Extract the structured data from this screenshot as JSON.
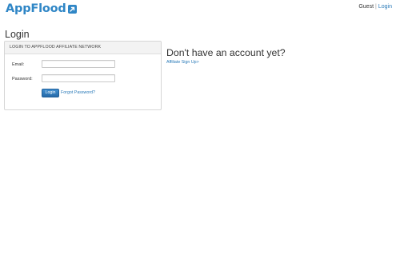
{
  "header": {
    "logo_text": "AppFlood",
    "user_label": "Guest",
    "separator": "|",
    "login_link": "Login"
  },
  "page": {
    "title": "Login"
  },
  "login_panel": {
    "heading": "LOGIN TO APPFLOOD AFFILIATE NETWORK",
    "email_label": "Email:",
    "email_value": "",
    "password_label": "Password:",
    "password_value": "",
    "login_button": "Login",
    "forgot_link": "Forgot Password?"
  },
  "signup": {
    "title": "Don't have an account yet?",
    "link_label": "Affiliate Sign Up",
    "link_arrow": ">"
  },
  "colors": {
    "brand": "#2f86c6",
    "link": "#2a7ab8",
    "button": "#2569a8"
  }
}
